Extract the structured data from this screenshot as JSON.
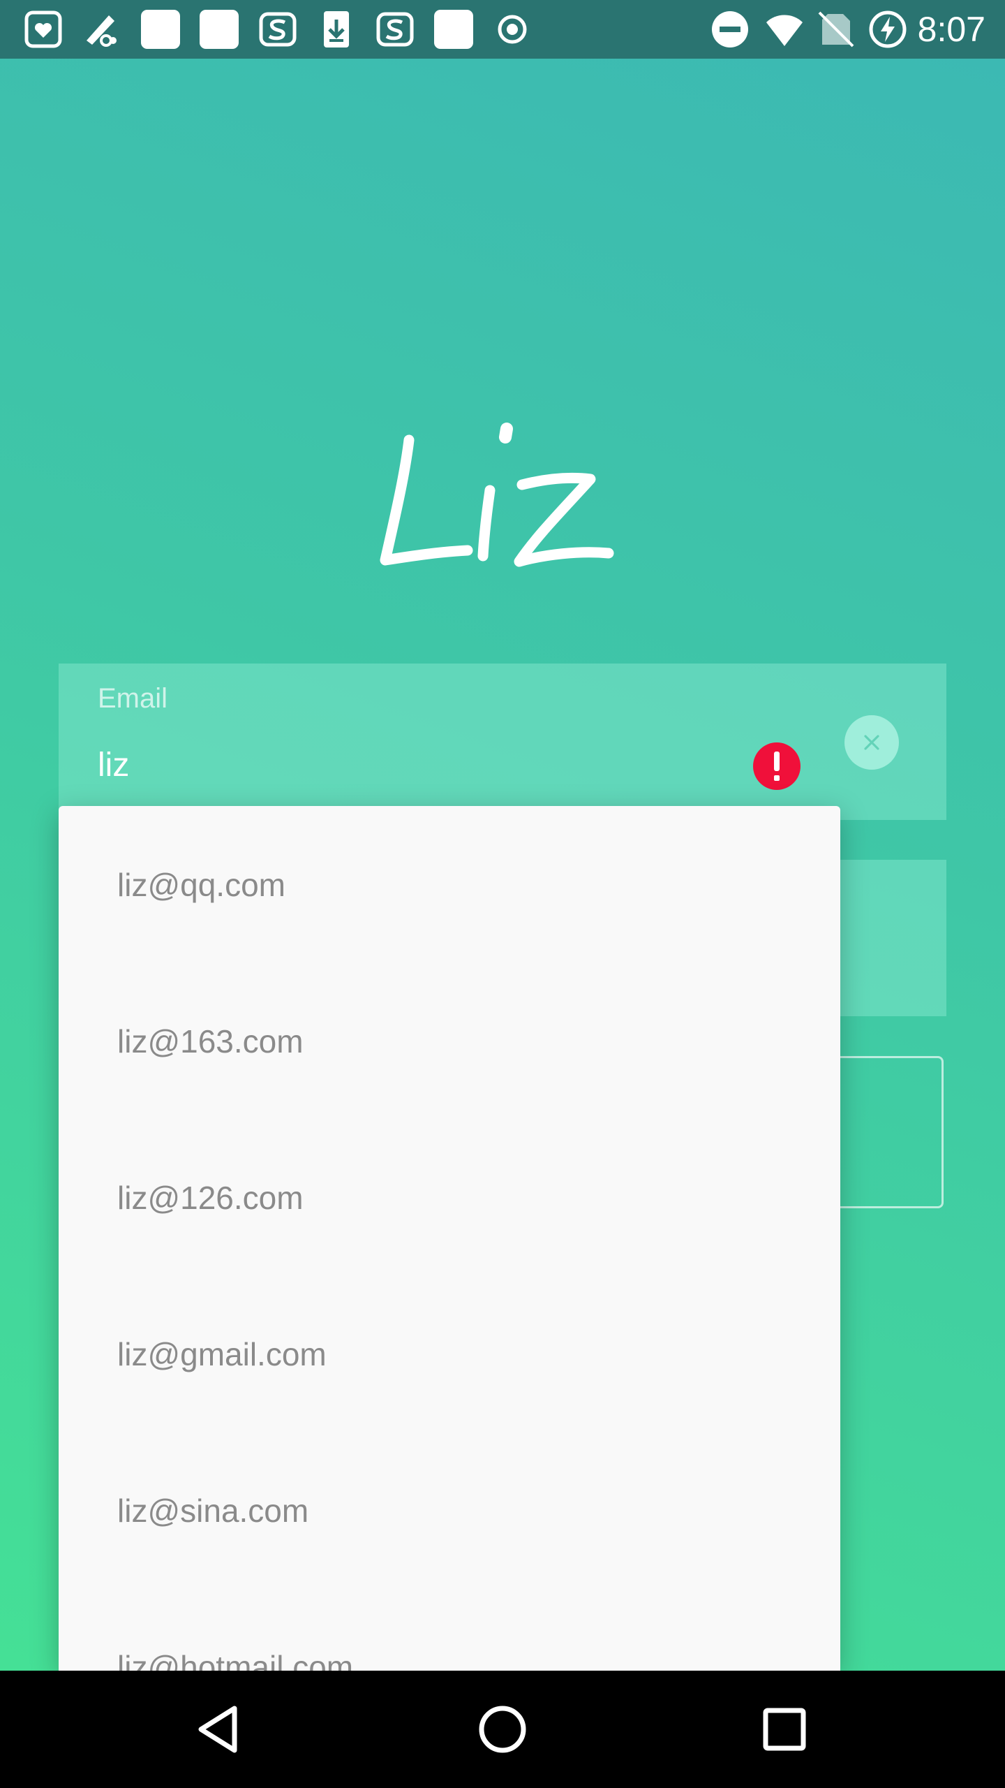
{
  "status_bar": {
    "time": "8:07",
    "left_icons": [
      "shield-heart-icon",
      "downloader-icon",
      "blank-app-icon",
      "blank-app-icon",
      "s-app-icon",
      "download-icon",
      "s-app-icon",
      "blank-app-icon",
      "record-icon"
    ],
    "right_icons": [
      "do-not-disturb-icon",
      "wifi-icon",
      "no-sim-icon",
      "battery-charging-icon"
    ]
  },
  "app": {
    "logo_text": "Liz"
  },
  "email_field": {
    "label": "Email",
    "value": "liz"
  },
  "autocomplete": {
    "items": [
      "liz@qq.com",
      "liz@163.com",
      "liz@126.com",
      "liz@gmail.com",
      "liz@sina.com",
      "liz@hotmail.com"
    ]
  },
  "colors": {
    "accent_top": "#3cb8b4",
    "accent_bottom": "#45e096",
    "error": "#f0103a",
    "status_bar": "#2a7471"
  }
}
